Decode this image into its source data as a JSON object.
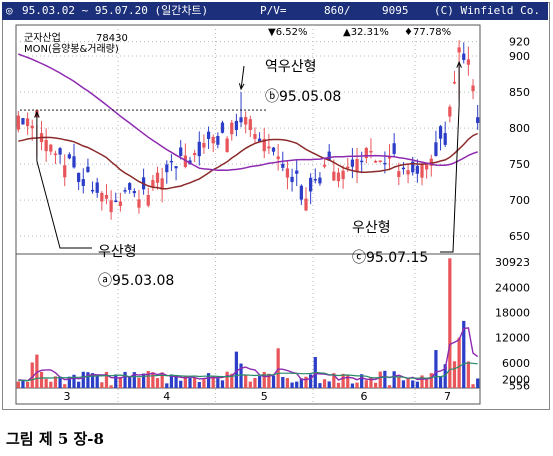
{
  "header": {
    "icon": "circle-icon",
    "range": "95.03.02 ~ 95.07.20 (일간차트)",
    "pv_label": "P/V=",
    "pv_value": "860/",
    "volume": "9095",
    "copyright": "(C) Winfield Co."
  },
  "stats": {
    "down": "▼6.52%",
    "up": "▲32.31%",
    "plus": "♦77.78%"
  },
  "legend": {
    "company": "군자산업",
    "price": "78430",
    "indicator": "MON(음양봉&거래량)"
  },
  "annotations": {
    "a_label": "우산형",
    "a_date": "ⓐ95.03.08",
    "b_label": "역우산형",
    "b_date": "ⓑ95.05.08",
    "c_label": "우산형",
    "c_date": "ⓒ95.07.15"
  },
  "caption": "그림 제 5 장-8",
  "colors": {
    "up": "#e8555a",
    "down": "#2c3ec8",
    "ma_fast": "#8c2a2a",
    "ma_slow": "#8e2ab0",
    "header_bg": "#1c2f7a",
    "grid": "#b8b8b8"
  },
  "chart_data": {
    "type": "candlestick",
    "price_ticks": [
      920,
      900,
      850,
      800,
      750,
      700,
      650
    ],
    "price_range": [
      628,
      932
    ],
    "volume_ticks": [
      "30923",
      "24000",
      "18000",
      "12000",
      "6000",
      "2000",
      "556"
    ],
    "volume_range": [
      0,
      31000
    ],
    "months": [
      "3",
      "4",
      "5",
      "6",
      "7"
    ],
    "month_boundaries": [
      22,
      43,
      64,
      86
    ],
    "n_days": 100,
    "ma_slow_start": 905,
    "pattern_markers": {
      "a": 4,
      "b": 48,
      "c": 95
    },
    "resistance_level": 825
  }
}
